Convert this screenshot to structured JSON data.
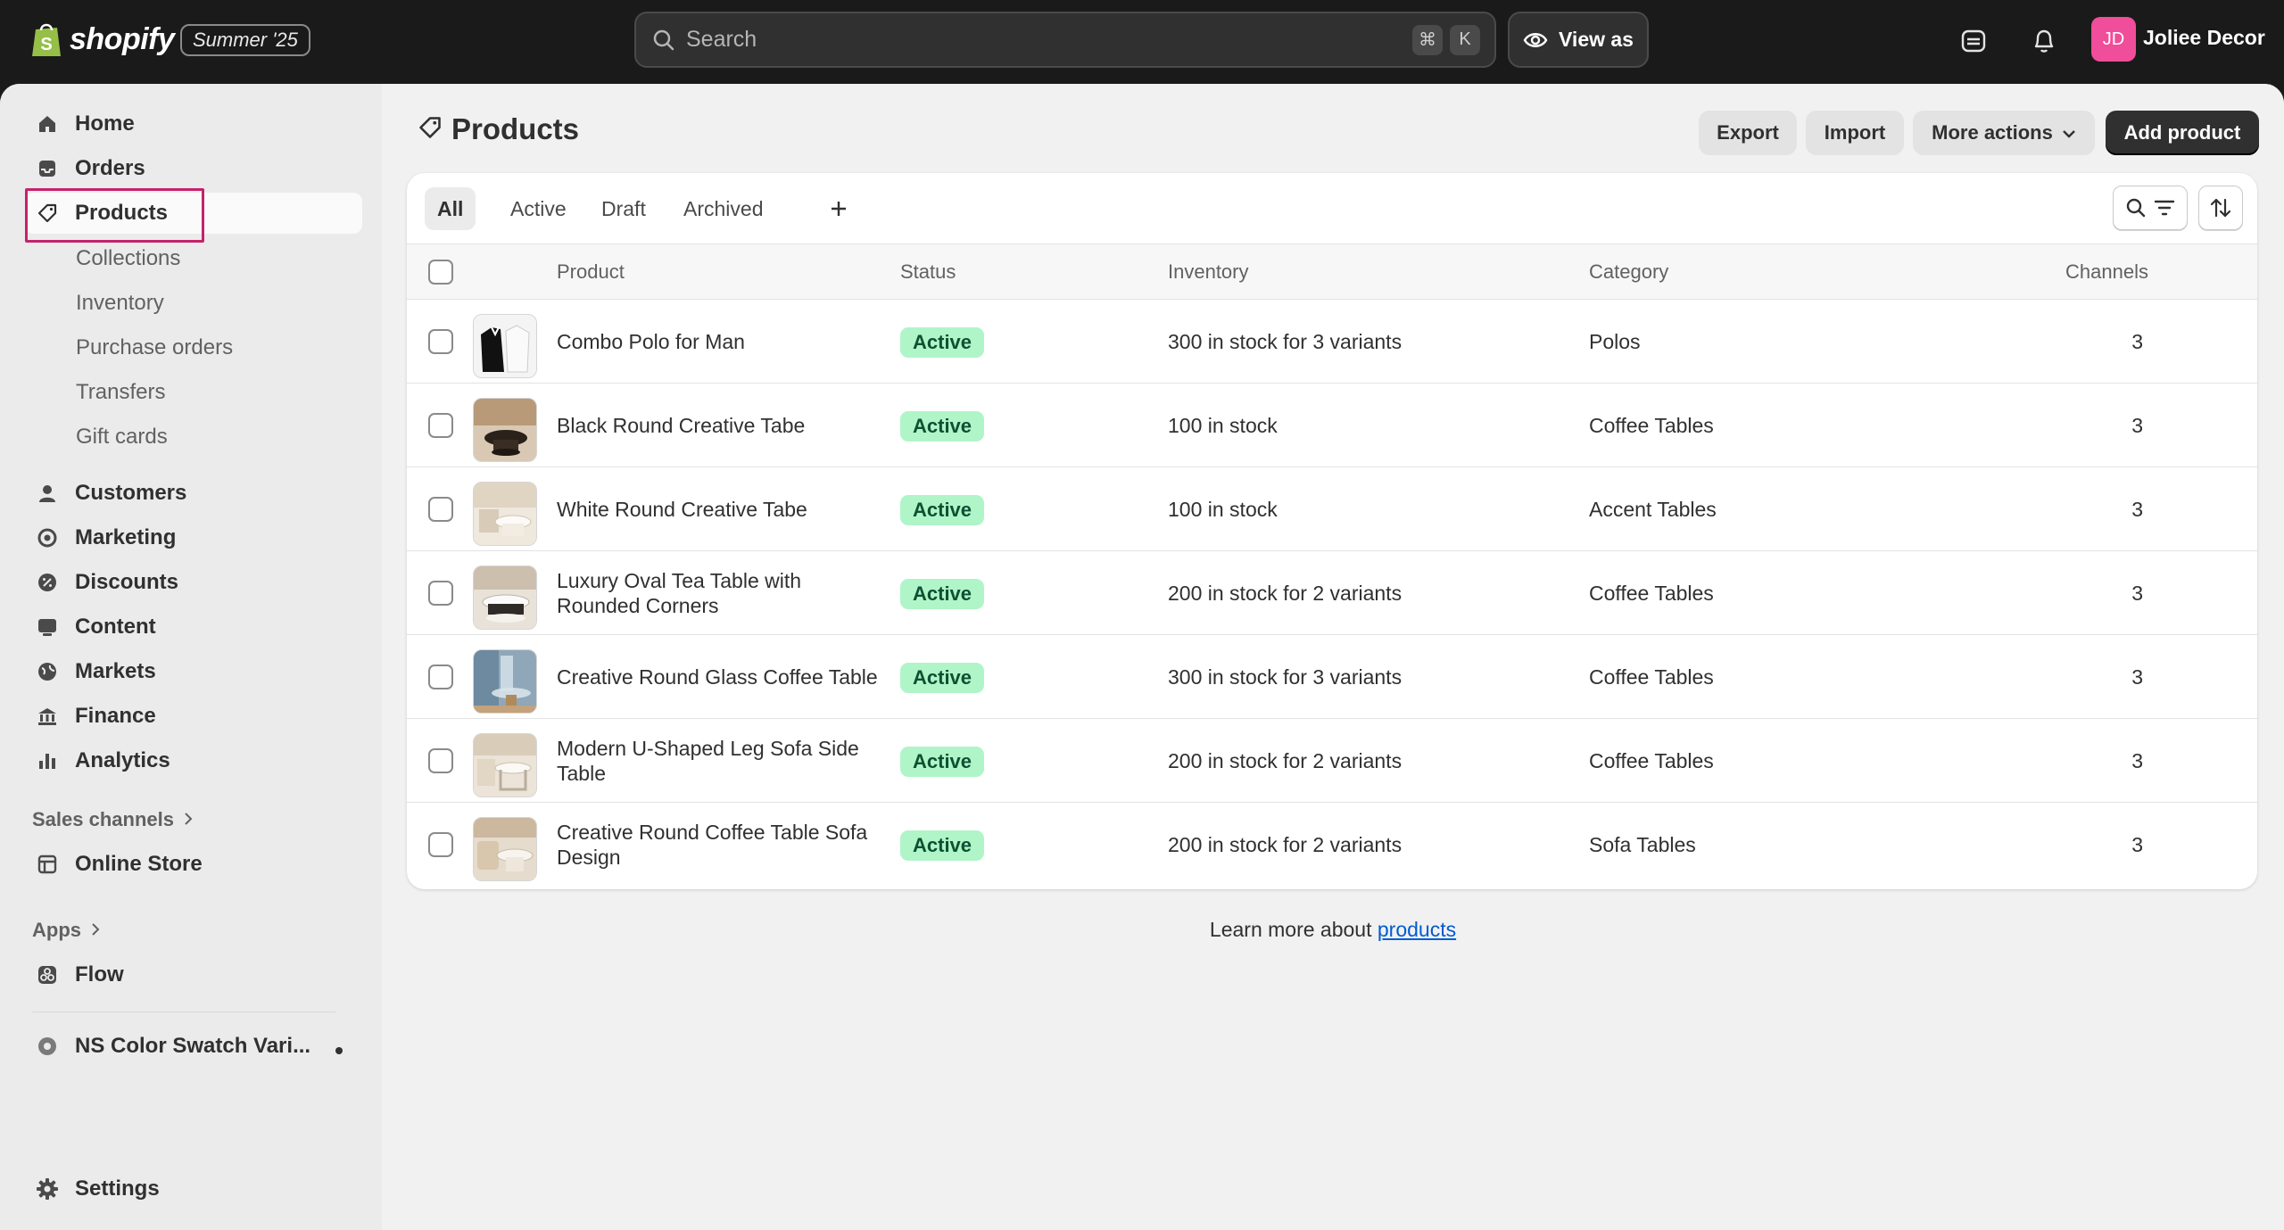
{
  "topbar": {
    "logo_text": "shopify",
    "edition": "Summer '25",
    "search_placeholder": "Search",
    "shortcut_keys": [
      "⌘",
      "K"
    ],
    "view_as_label": "View as",
    "avatar_initials": "JD",
    "store_name": "Joliee Decor",
    "icons": [
      "store-sync-icon",
      "bell-icon"
    ],
    "avatar_color": "#f04d9a"
  },
  "sidebar": {
    "items": [
      {
        "label": "Home",
        "icon": "home-icon"
      },
      {
        "label": "Orders",
        "icon": "inbox-icon"
      },
      {
        "label": "Products",
        "icon": "tag-icon",
        "active": true
      },
      {
        "label": "Customers",
        "icon": "person-icon"
      },
      {
        "label": "Marketing",
        "icon": "target-icon"
      },
      {
        "label": "Discounts",
        "icon": "discount-icon"
      },
      {
        "label": "Content",
        "icon": "content-icon"
      },
      {
        "label": "Markets",
        "icon": "globe-icon"
      },
      {
        "label": "Finance",
        "icon": "bank-icon"
      },
      {
        "label": "Analytics",
        "icon": "bar-chart-icon"
      }
    ],
    "product_subitems": [
      "Collections",
      "Inventory",
      "Purchase orders",
      "Transfers",
      "Gift cards"
    ],
    "sales_channels_label": "Sales channels",
    "online_store_label": "Online Store",
    "apps_label": "Apps",
    "flow_label": "Flow",
    "ns_app_label": "NS Color Swatch Vari...",
    "settings_label": "Settings"
  },
  "page": {
    "title": "Products",
    "export_label": "Export",
    "import_label": "Import",
    "more_actions_label": "More actions",
    "add_product_label": "Add product"
  },
  "tabs": [
    "All",
    "Active",
    "Draft",
    "Archived"
  ],
  "table": {
    "columns": [
      "Product",
      "Status",
      "Inventory",
      "Category",
      "Channels"
    ],
    "rows": [
      {
        "product": "Combo Polo for Man",
        "status": "Active",
        "inventory": "300 in stock for 3 variants",
        "category": "Polos",
        "channels": "3"
      },
      {
        "product": "Black Round Creative Tabe",
        "status": "Active",
        "inventory": "100 in stock",
        "category": "Coffee Tables",
        "channels": "3"
      },
      {
        "product": "White Round Creative Tabe",
        "status": "Active",
        "inventory": "100 in stock",
        "category": "Accent Tables",
        "channels": "3"
      },
      {
        "product": "Luxury Oval Tea Table with Rounded Corners",
        "status": "Active",
        "inventory": "200 in stock for 2 variants",
        "category": "Coffee Tables",
        "channels": "3"
      },
      {
        "product": "Creative Round Glass Coffee Table",
        "status": "Active",
        "inventory": "300 in stock for 3 variants",
        "category": "Coffee Tables",
        "channels": "3"
      },
      {
        "product": "Modern U-Shaped Leg Sofa Side Table",
        "status": "Active",
        "inventory": "200 in stock for 2 variants",
        "category": "Coffee Tables",
        "channels": "3"
      },
      {
        "product": "Creative Round Coffee Table Sofa Design",
        "status": "Active",
        "inventory": "200 in stock for 2 variants",
        "category": "Sofa Tables",
        "channels": "3"
      }
    ]
  },
  "footer": {
    "learn_more_text": "Learn more about",
    "link_text": "products"
  },
  "colors": {
    "topbar_bg": "#1a1a1a",
    "active_badge_bg": "#aff5c8",
    "active_badge_text": "#0c5132",
    "highlight_border": "#c3236b",
    "link": "#005bd3"
  }
}
